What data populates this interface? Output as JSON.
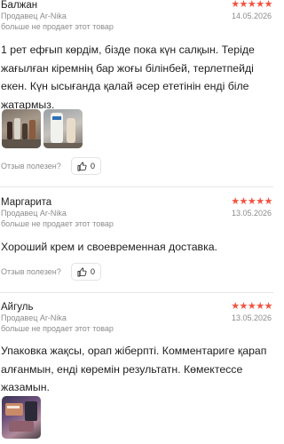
{
  "reviews": [
    {
      "author": "Балжан",
      "stars": "★★★★★",
      "seller": "Продавец Ar-Nika",
      "date": "14.05.2026",
      "note": "больше не продает этот товар",
      "text": "1 рет ефғып көрдім, бізде пока күн салқын. Теріде жағылған кіремнің бар жоғы білінбей, терлетпейді екен. Күн ысығанда қалай әсер ететінін енді біле жатармыз.",
      "helpful_label": "Отзыв полезен?",
      "likes": "0"
    },
    {
      "author": "Маргарита",
      "stars": "★★★★★",
      "seller": "Продавец Ar-Nika",
      "date": "13.05.2026",
      "note": "больше не продает этот товар",
      "text": "Хороший крем и своевременная доставка.",
      "helpful_label": "Отзыв полезен?",
      "likes": "0"
    },
    {
      "author": "Айгуль",
      "stars": "★★★★★",
      "seller": "Продавец Ar-Nika",
      "date": "13.05.2026",
      "note": "больше не продает этот товар",
      "text": "Упаковка жақсы, орап жіберпті. Комментариге қарап алғанмын, енді көремін результатн. Көмектессе жазамын."
    }
  ],
  "colors": {
    "star": "#f05440",
    "muted": "#8c8c8c",
    "text": "#1f1f1f",
    "divider": "#e6e6e6"
  },
  "icons": {
    "like": "thumbs-up-icon"
  }
}
